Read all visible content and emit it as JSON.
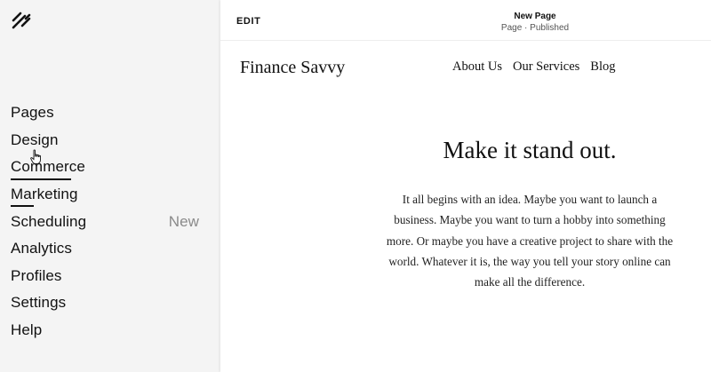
{
  "sidebar": {
    "logo": "squarespace-logo",
    "items": [
      {
        "label": "Pages"
      },
      {
        "label": "Design"
      },
      {
        "label": "Commerce"
      },
      {
        "label": "Marketing"
      },
      {
        "label": "Scheduling",
        "badge": "New"
      },
      {
        "label": "Analytics"
      },
      {
        "label": "Profiles"
      },
      {
        "label": "Settings"
      },
      {
        "label": "Help"
      }
    ]
  },
  "topbar": {
    "edit_label": "EDIT",
    "page_title": "New Page",
    "page_status": "Page · Published"
  },
  "site": {
    "title": "Finance Savvy",
    "nav": [
      "About Us",
      "Our Services",
      "Blog"
    ],
    "heading": "Make it stand out.",
    "body": "It all begins with an idea. Maybe you want to launch a business. Maybe you want to turn a hobby into something more. Or maybe you have a creative project to share with the world. Whatever it is, the way you tell your story online can make all the difference."
  }
}
